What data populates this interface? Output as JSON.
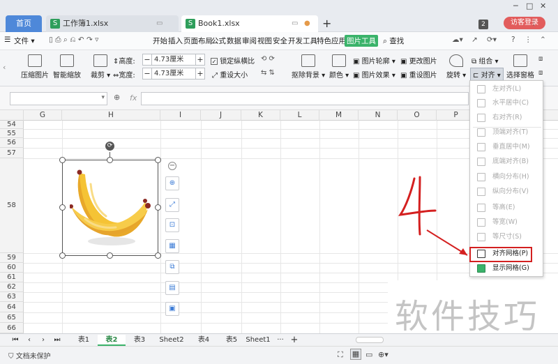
{
  "tabbar": {
    "home": "首页",
    "tab1": "工作簿1.xlsx",
    "tab2": "Book1.xlsx",
    "newtab": "+",
    "badge": "2",
    "login": "访客登录"
  },
  "menubar": {
    "file": "文件",
    "items": [
      "开始",
      "插入",
      "页面布局",
      "公式",
      "数据",
      "审阅",
      "视图",
      "安全",
      "开发工具",
      "特色应用"
    ],
    "active": "图片工具",
    "search": "查找"
  },
  "ribbon": {
    "compress": "压缩图片",
    "smartzoom": "智能缩放",
    "crop": "裁剪",
    "height_label": "高度:",
    "height_value": "4.73厘米",
    "width_label": "宽度:",
    "width_value": "4.73厘米",
    "lock_ratio": "锁定纵横比",
    "reset_size": "重设大小",
    "remove_bg": "抠除背景",
    "color": "颜色",
    "outline": "图片轮廓",
    "effect": "图片效果",
    "change_pic": "更改图片",
    "reset_pic": "重设图片",
    "rotate": "旋转",
    "group": "组合",
    "align": "对齐",
    "select_pane": "选择窗格"
  },
  "formula": {
    "fx": "fx"
  },
  "columns": [
    "G",
    "H",
    "I",
    "J",
    "K",
    "L",
    "M",
    "N",
    "O",
    "P"
  ],
  "rows": [
    "54",
    "55",
    "56",
    "57",
    "58",
    "59",
    "60",
    "61",
    "62",
    "63",
    "64",
    "65",
    "66"
  ],
  "dropdown": {
    "items": [
      {
        "label": "左对齐(L)",
        "enabled": false
      },
      {
        "label": "水平居中(C)",
        "enabled": false
      },
      {
        "label": "右对齐(R)",
        "enabled": false
      },
      {
        "label": "顶端对齐(T)",
        "enabled": false
      },
      {
        "label": "垂直居中(M)",
        "enabled": false
      },
      {
        "label": "底端对齐(B)",
        "enabled": false
      },
      {
        "label": "横向分布(H)",
        "enabled": false
      },
      {
        "label": "纵向分布(V)",
        "enabled": false
      },
      {
        "label": "等高(E)",
        "enabled": false
      },
      {
        "label": "等宽(W)",
        "enabled": false
      },
      {
        "label": "等尺寸(S)",
        "enabled": false
      },
      {
        "label": "对齐网格(P)",
        "enabled": true
      },
      {
        "label": "显示网格(G)",
        "enabled": true
      }
    ]
  },
  "annotation": {
    "text": "4",
    "color": "#d42020"
  },
  "sheets": {
    "tabs": [
      "表1",
      "表2",
      "表3",
      "Sheet2",
      "表4",
      "表5",
      "Sheet1"
    ],
    "active": "表2",
    "more": "···",
    "add": "+"
  },
  "status": {
    "protect": "文档未保护"
  },
  "watermark": "软件技巧",
  "colors": {
    "accent": "#3ab36a",
    "home_tab": "#4e88d9",
    "highlight": "#d32020",
    "banana": "#f5c335"
  }
}
